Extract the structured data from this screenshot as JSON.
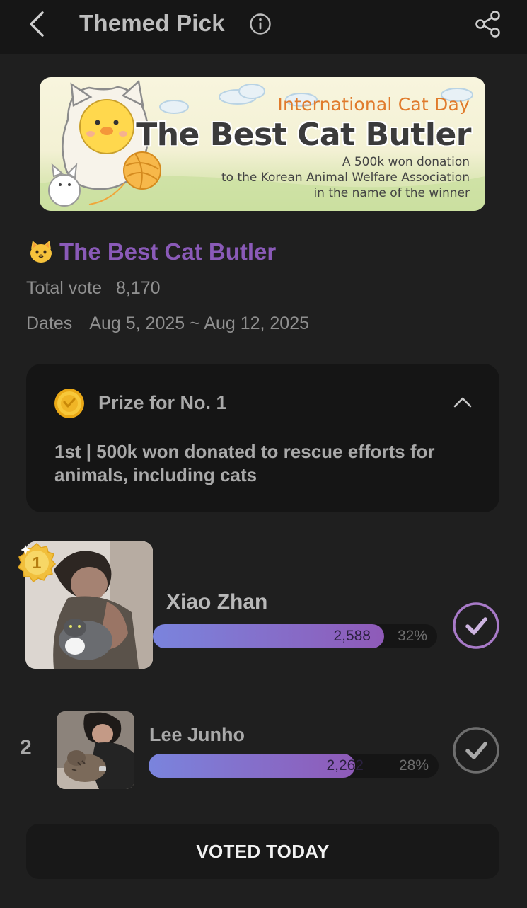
{
  "header": {
    "title": "Themed Pick",
    "back_icon": "chevron-left-icon",
    "info_icon": "info-icon",
    "share_icon": "share-icon"
  },
  "banner": {
    "subtitle": "International Cat Day",
    "title": "The Best Cat Butler",
    "line1": "A 500k won donation",
    "line2": "to the Korean Animal Welfare Association",
    "line3": "in the name of the winner"
  },
  "event": {
    "emoji": "cat-face-icon",
    "title": "The Best Cat Butler",
    "total_vote_label": "Total vote",
    "total_vote_value": "8,170",
    "dates_label": "Dates",
    "dates_value": "Aug 5, 2025 ~ Aug 12, 2025"
  },
  "prize": {
    "icon": "coin-icon",
    "title": "Prize for No. 1",
    "description": "1st | 500k won donated to rescue efforts for animals, including cats",
    "expanded": true
  },
  "candidates": [
    {
      "rank": "1",
      "name": "Xiao Zhan",
      "votes": "2,588",
      "percent": "32%",
      "fill_fraction": 0.32
    },
    {
      "rank": "2",
      "name": "Lee Junho",
      "votes": "2,262",
      "percent": "28%",
      "fill_fraction": 0.28
    }
  ],
  "cta": {
    "label": "VOTED TODAY"
  },
  "colors": {
    "accent": "#8a5ab8",
    "bar_start": "#7a84dd",
    "bar_end": "#8f5ab8",
    "background": "#1f1f1f"
  }
}
